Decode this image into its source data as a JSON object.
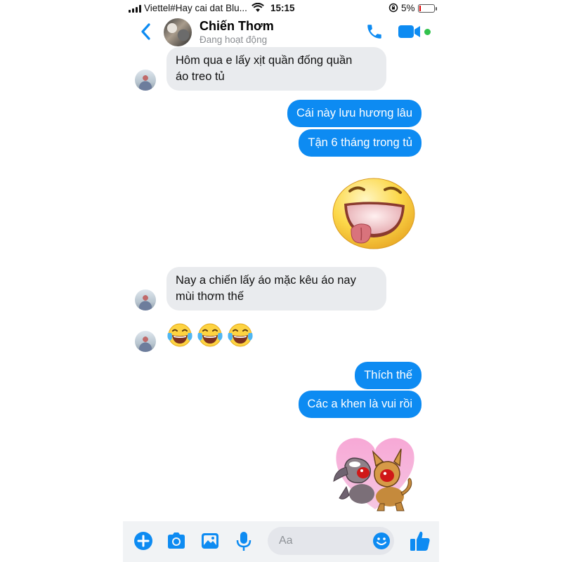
{
  "status_bar": {
    "carrier": "Viettel#Hay cai dat Blu...",
    "time": "15:15",
    "battery_pct": "5%",
    "battery_level": 0.05
  },
  "header": {
    "contact_name": "Chiến Thơm",
    "presence": "Đang hoạt động"
  },
  "colors": {
    "accent": "#0d8bf2",
    "incoming_bubble": "#e9ebee",
    "online": "#31c24d"
  },
  "messages": [
    {
      "from": "them",
      "lines": [
        "Hôm qua e lấy xịt quần đống quần",
        "áo treo tủ"
      ]
    },
    {
      "from": "me",
      "text": "Cái này lưu hương lâu"
    },
    {
      "from": "me",
      "text": "Tận 6 tháng trong tủ"
    },
    {
      "from": "me",
      "sticker": "big-grin-tongue-sticker"
    },
    {
      "from": "them",
      "lines": [
        "Nay a chiến lấy áo mặc kêu áo nay",
        "mùi thơm thế"
      ]
    },
    {
      "from": "them",
      "emoji": [
        "😂",
        "😂",
        "😂"
      ]
    },
    {
      "from": "me",
      "text": "Thích thế"
    },
    {
      "from": "me",
      "text": "Các a khen là vui rồi"
    },
    {
      "from": "me",
      "sticker": "dogs-heart-sticker"
    }
  ],
  "composer": {
    "placeholder": "Aa",
    "icons": [
      "plus-icon",
      "camera-icon",
      "gallery-icon",
      "microphone-icon",
      "emoji-icon",
      "thumbs-up-icon"
    ]
  }
}
